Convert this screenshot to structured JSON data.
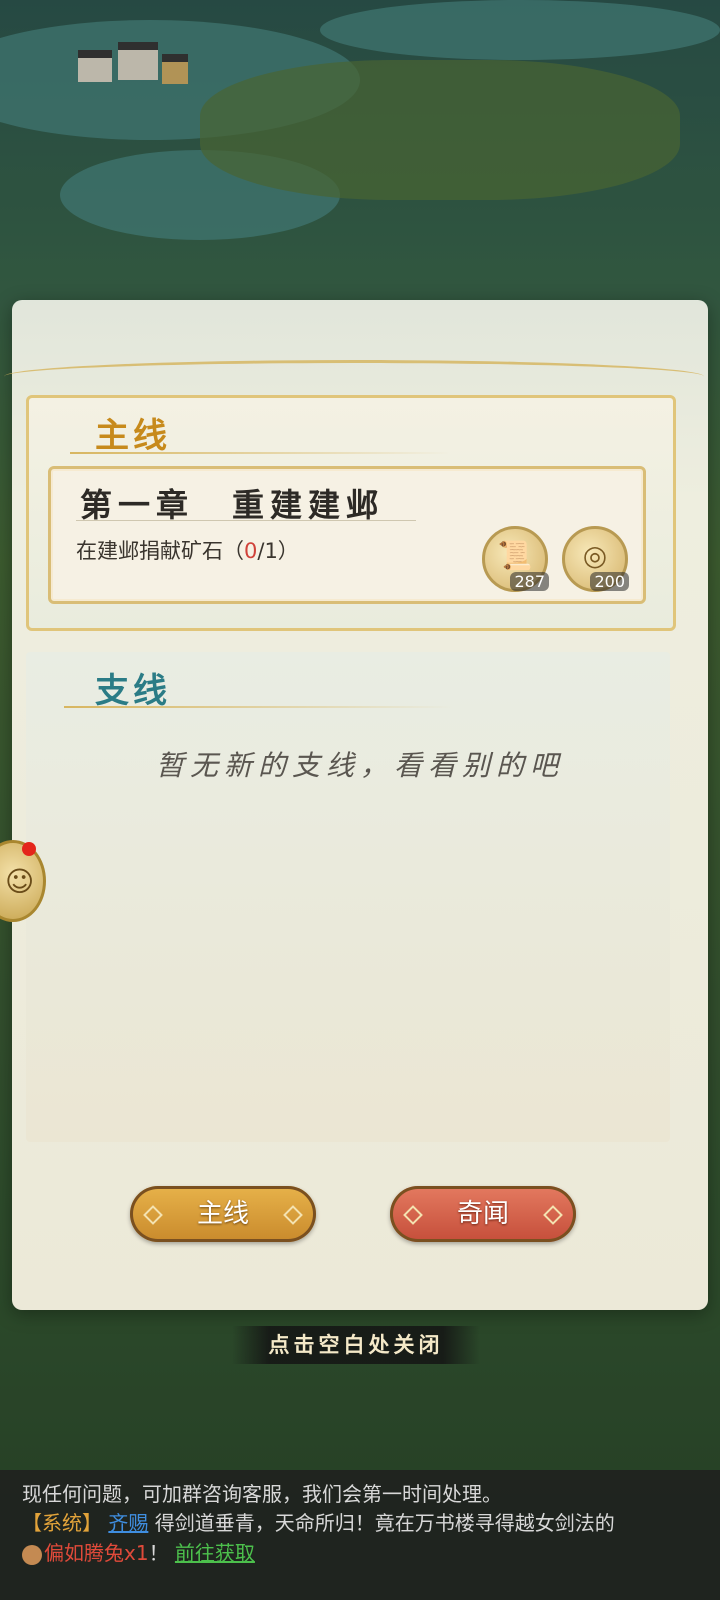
{
  "panel": {
    "main_section_title": "主线",
    "side_section_title": "支线",
    "quest": {
      "title": "第一章　重建建邺",
      "desc_prefix": "在建邺捐献矿石（",
      "progress_current": "0",
      "progress_rest": "/1）"
    },
    "rewards": [
      {
        "icon": "scroll-icon",
        "count": "287"
      },
      {
        "icon": "coin-icon",
        "count": "200"
      }
    ],
    "side_empty_text": "暂无新的支线，看看别的吧",
    "buttons": {
      "main": "主线",
      "odd": "奇闻"
    }
  },
  "close_hint": "点击空白处关闭",
  "chat": {
    "line1": "现任何问题，可加群咨询客服，我们会第一时间处理。",
    "line2_tag": "【系统】",
    "line2_name": "齐赐",
    "line2_text": "得剑道垂青，天命所归！竟在万书楼寻得越女剑法的",
    "line3_item": "偏如腾兔x1",
    "line3_excl": "！",
    "line3_link": "前往获取"
  },
  "colors": {
    "accent_gold": "#c78a1c",
    "accent_teal": "#2b7c86",
    "progress_red": "#d0423a",
    "link_blue": "#3f8ee0",
    "link_green": "#4cc04c"
  }
}
